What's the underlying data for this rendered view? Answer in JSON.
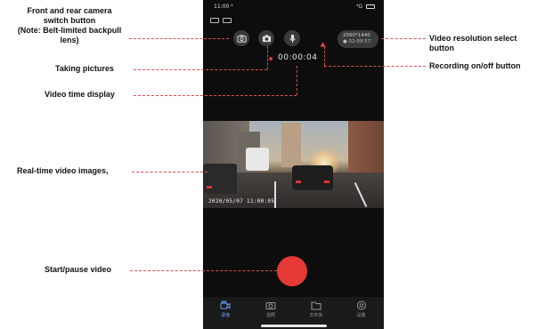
{
  "phone": {
    "status_time": "11:00 ⁴",
    "status_right": "⁴G",
    "timer": "00:00:04",
    "resolution_line1": "2560*1440",
    "resolution_line2": "● 02:09:57",
    "video_timestamp": "2020/05/07 11:00:05",
    "tabs": [
      {
        "label": "录像",
        "icon": "video-camera-icon",
        "active": true
      },
      {
        "label": "拍照",
        "icon": "camera-icon",
        "active": false
      },
      {
        "label": "文件夹",
        "icon": "folder-icon",
        "active": false
      },
      {
        "label": "设置",
        "icon": "settings-icon",
        "active": false
      }
    ]
  },
  "annotations": {
    "camera_switch_1": "Front and rear camera",
    "camera_switch_2": "switch button",
    "camera_switch_3": "(Note: Belt-limited backpull",
    "camera_switch_4": "lens)",
    "taking_pictures": "Taking pictures",
    "video_time": "Video time display",
    "realtime": "Real-time video images,",
    "start_pause": "Start/pause video",
    "resolution_1": "Video resolution select",
    "resolution_2": "button",
    "recording": "Recording on/off button"
  },
  "colors": {
    "accent_red": "#e53935",
    "leader_line": "#e05050",
    "tab_active": "#6aa3ff",
    "phone_bg": "#0d0d0d"
  }
}
